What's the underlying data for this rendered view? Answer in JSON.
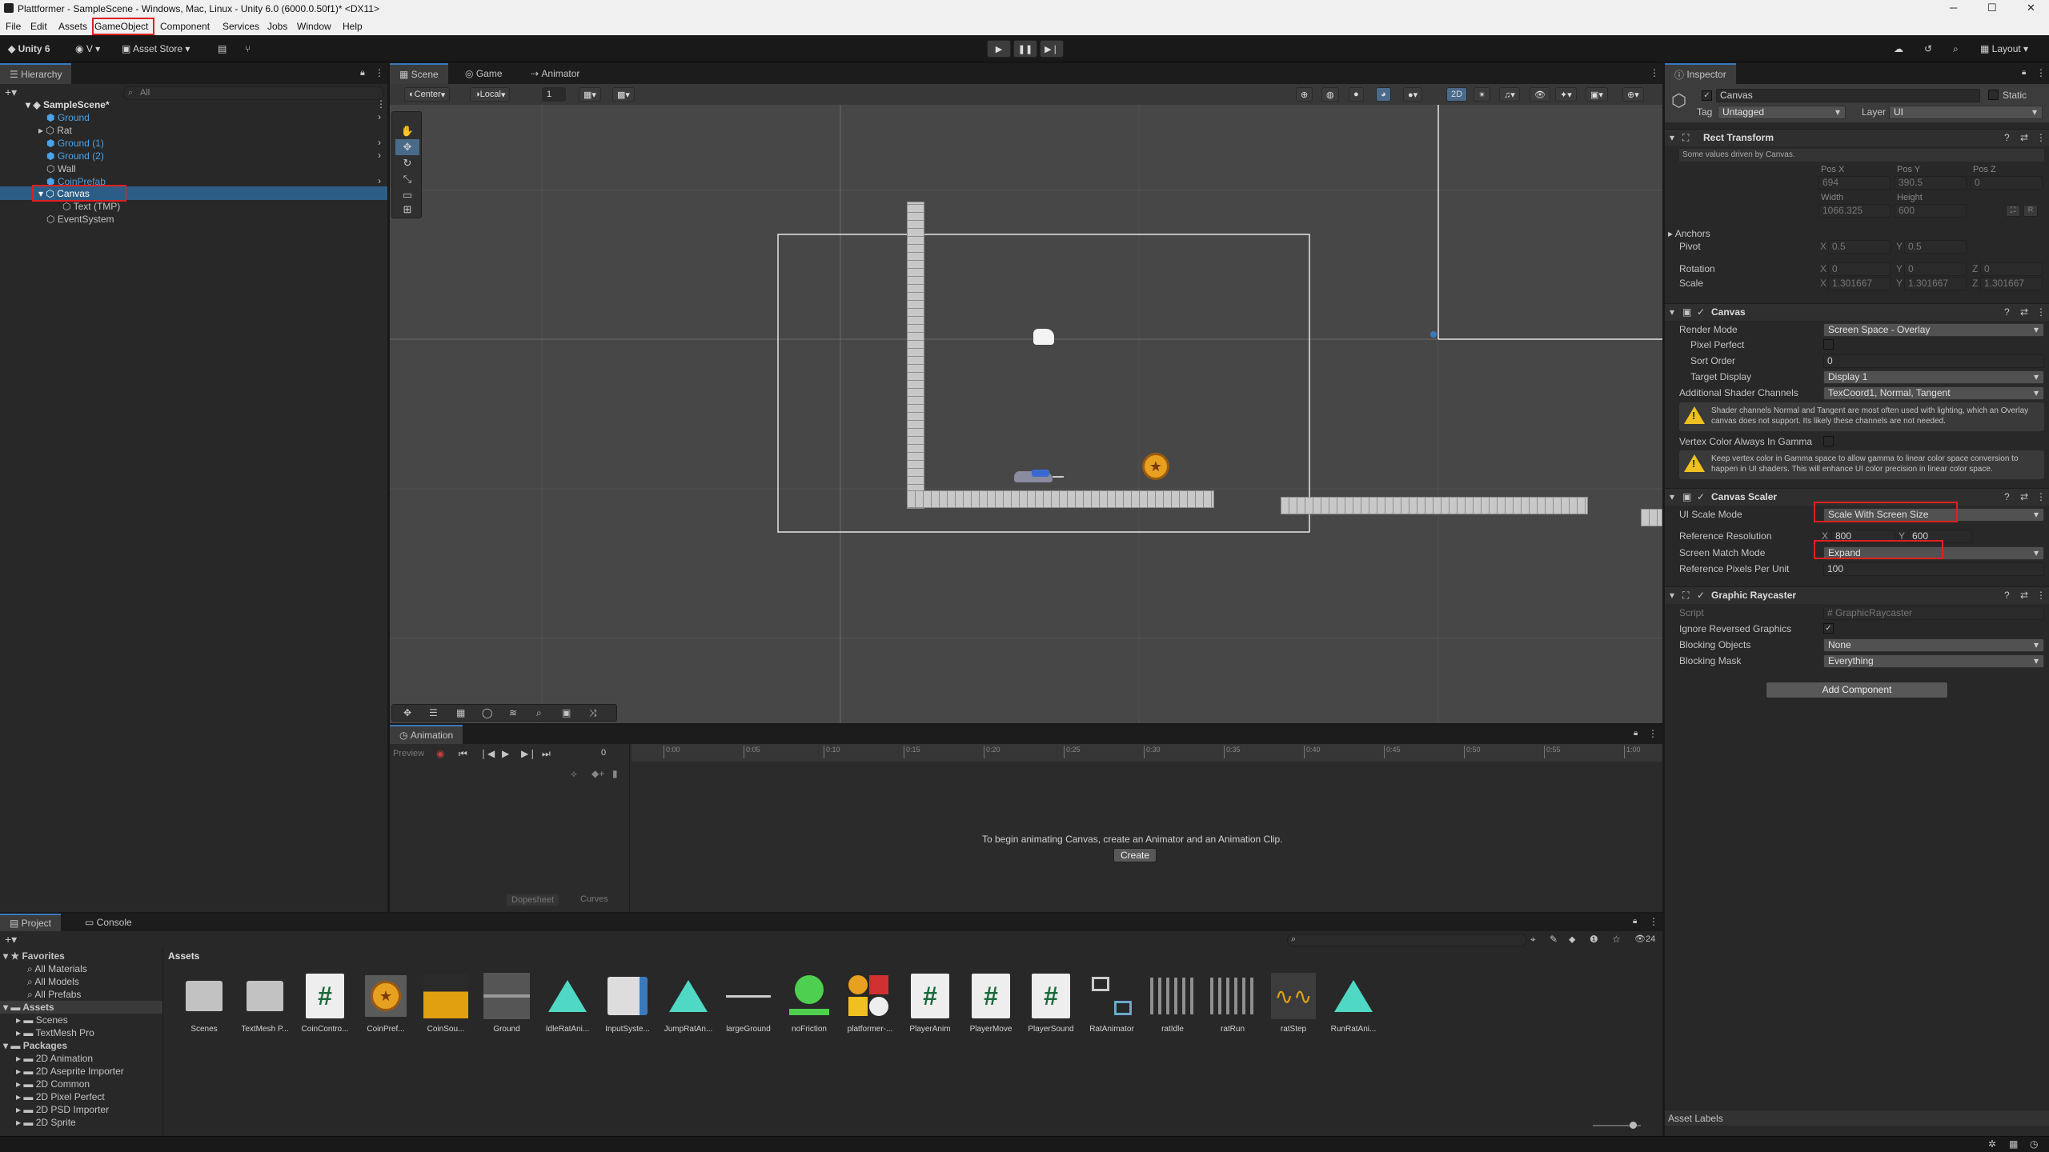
{
  "window": {
    "title": "Plattformer - SampleScene - Windows, Mac, Linux - Unity 6.0 (6000.0.50f1)* <DX11>"
  },
  "menu": [
    "File",
    "Edit",
    "Assets",
    "GameObject",
    "Component",
    "Services",
    "Jobs",
    "Window",
    "Help"
  ],
  "toolbar": {
    "brand": "Unity 6",
    "account": "V",
    "asset_store": "Asset Store",
    "layout": "Layout"
  },
  "hierarchy": {
    "tab": "Hierarchy",
    "search_placeholder": "All",
    "scene": "SampleScene*",
    "items": [
      {
        "label": "Ground",
        "prefab": true
      },
      {
        "label": "Rat",
        "prefab": false
      },
      {
        "label": "Ground (1)",
        "prefab": true
      },
      {
        "label": "Ground (2)",
        "prefab": true
      },
      {
        "label": "Wall",
        "prefab": false
      },
      {
        "label": "CoinPrefab",
        "prefab": true
      },
      {
        "label": "Canvas",
        "prefab": false,
        "selected": true
      },
      {
        "label": "Text (TMP)",
        "prefab": false
      },
      {
        "label": "EventSystem",
        "prefab": false
      }
    ]
  },
  "scene_view": {
    "tabs": [
      "Scene",
      "Game",
      "Animator"
    ],
    "pivot": "Center",
    "space": "Local",
    "grid_value": "1",
    "mode_2d": "2D"
  },
  "animation": {
    "tab": "Animation",
    "preview": "Preview",
    "frame": "0",
    "ticks": [
      "0:00",
      "0:05",
      "0:10",
      "0:15",
      "0:20",
      "0:25",
      "0:30",
      "0:35",
      "0:40",
      "0:45",
      "0:50",
      "0:55",
      "1:00"
    ],
    "message": "To begin animating Canvas, create an Animator and an Animation Clip.",
    "create_button": "Create",
    "dopesheet": "Dopesheet",
    "curves": "Curves"
  },
  "inspector": {
    "tab": "Inspector",
    "object_name": "Canvas",
    "static_label": "Static",
    "tag_label": "Tag",
    "tag_value": "Untagged",
    "layer_label": "Layer",
    "layer_value": "UI",
    "rect_transform": {
      "title": "Rect Transform",
      "note": "Some values driven by Canvas.",
      "pos_x_label": "Pos X",
      "pos_y_label": "Pos Y",
      "pos_z_label": "Pos Z",
      "pos_x": "694",
      "pos_y": "390.5",
      "pos_z": "0",
      "width_label": "Width",
      "height_label": "Height",
      "width": "1066.325",
      "height": "600",
      "anchors": "Anchors",
      "pivot": "Pivot",
      "pivot_x": "0.5",
      "pivot_y": "0.5",
      "rotation": "Rotation",
      "rot_x": "0",
      "rot_y": "0",
      "rot_z": "0",
      "scale": "Scale",
      "scale_x": "1.301667",
      "scale_y": "1.301667",
      "scale_z": "1.301667",
      "x": "X",
      "y": "Y",
      "z": "Z",
      "r_btn": "R"
    },
    "canvas": {
      "title": "Canvas",
      "render_mode_label": "Render Mode",
      "render_mode": "Screen Space - Overlay",
      "pixel_perfect": "Pixel Perfect",
      "sort_order_label": "Sort Order",
      "sort_order": "0",
      "target_display_label": "Target Display",
      "target_display": "Display 1",
      "shader_channels_label": "Additional Shader Channels",
      "shader_channels": "TexCoord1, Normal, Tangent",
      "warning1": "Shader channels Normal and Tangent are most often used with lighting, which an Overlay canvas does not support. Its likely these channels are not needed.",
      "vertex_color_label": "Vertex Color Always In Gamma",
      "warning2": "Keep vertex color in Gamma space to allow gamma to linear color space conversion to happen in UI shaders. This will enhance UI color precision in linear color space."
    },
    "canvas_scaler": {
      "title": "Canvas Scaler",
      "ui_scale_mode_label": "UI Scale Mode",
      "ui_scale_mode": "Scale With Screen Size",
      "ref_res_label": "Reference Resolution",
      "ref_x": "800",
      "ref_y": "600",
      "match_mode_label": "Screen Match Mode",
      "match_mode": "Expand",
      "ppu_label": "Reference Pixels Per Unit",
      "ppu": "100"
    },
    "graphic_raycaster": {
      "title": "Graphic Raycaster",
      "script_label": "Script",
      "script": "GraphicRaycaster",
      "ignore_label": "Ignore Reversed Graphics",
      "blocking_objects_label": "Blocking Objects",
      "blocking_objects": "None",
      "blocking_mask_label": "Blocking Mask",
      "blocking_mask": "Everything"
    },
    "add_component": "Add Component",
    "asset_labels": "Asset Labels"
  },
  "project": {
    "tabs": [
      "Project",
      "Console"
    ],
    "count": "24",
    "assets_header": "Assets",
    "favorites": "Favorites",
    "fav_items": [
      "All Materials",
      "All Models",
      "All Prefabs"
    ],
    "assets_root": "Assets",
    "asset_folders": [
      "Scenes",
      "TextMesh Pro"
    ],
    "packages": "Packages",
    "package_items": [
      "2D Animation",
      "2D Aseprite Importer",
      "2D Common",
      "2D Pixel Perfect",
      "2D PSD Importer",
      "2D Sprite"
    ],
    "assets": [
      {
        "label": "Scenes",
        "kind": "folder"
      },
      {
        "label": "TextMesh P...",
        "kind": "folder"
      },
      {
        "label": "CoinContro...",
        "kind": "script"
      },
      {
        "label": "CoinPref...",
        "kind": "coin"
      },
      {
        "label": "CoinSou...",
        "kind": "audio"
      },
      {
        "label": "Ground",
        "kind": "ground"
      },
      {
        "label": "IdleRatAni...",
        "kind": "anim"
      },
      {
        "label": "InputSyste...",
        "kind": "input"
      },
      {
        "label": "JumpRatAn...",
        "kind": "anim"
      },
      {
        "label": "largeGround",
        "kind": "line"
      },
      {
        "label": "noFriction",
        "kind": "physics"
      },
      {
        "label": "platformer-...",
        "kind": "sprites"
      },
      {
        "label": "PlayerAnim",
        "kind": "script"
      },
      {
        "label": "PlayerMove",
        "kind": "script"
      },
      {
        "label": "PlayerSound",
        "kind": "script"
      },
      {
        "label": "RatAnimator",
        "kind": "animator"
      },
      {
        "label": "ratIdle",
        "kind": "clip"
      },
      {
        "label": "ratRun",
        "kind": "clip"
      },
      {
        "label": "ratStep",
        "kind": "wave"
      },
      {
        "label": "RunRatAni...",
        "kind": "anim"
      }
    ]
  },
  "colors": {
    "accent": "#3a79bb",
    "selected_row": "#2c5d87",
    "prefab_blue": "#4ba3e8",
    "highlight_red": "#e02020"
  }
}
